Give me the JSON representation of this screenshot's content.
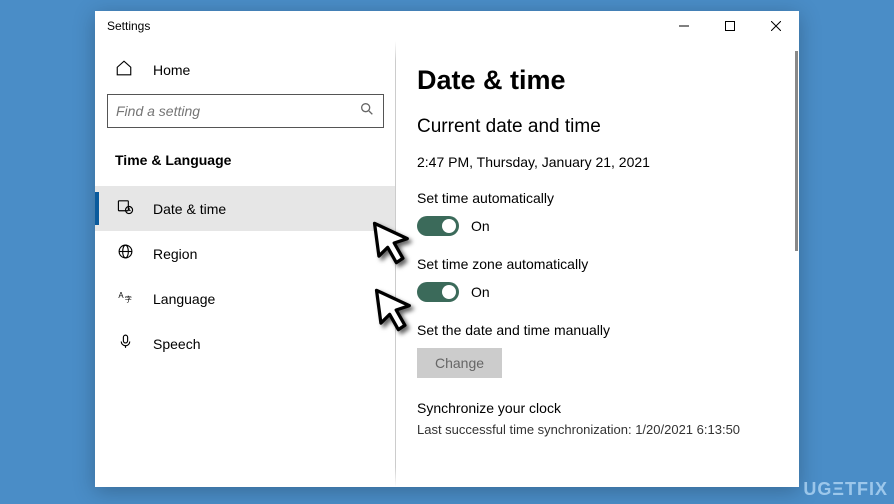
{
  "window": {
    "title": "Settings"
  },
  "sidebar": {
    "home_label": "Home",
    "search_placeholder": "Find a setting",
    "section": "Time & Language",
    "items": [
      {
        "label": "Date & time"
      },
      {
        "label": "Region"
      },
      {
        "label": "Language"
      },
      {
        "label": "Speech"
      }
    ]
  },
  "main": {
    "heading": "Date & time",
    "subheading": "Current date and time",
    "timestamp": "2:47 PM, Thursday, January 21, 2021",
    "set_time_auto_label": "Set time automatically",
    "set_time_auto_state": "On",
    "set_tz_auto_label": "Set time zone automatically",
    "set_tz_auto_state": "On",
    "manual_label": "Set the date and time manually",
    "change_label": "Change",
    "sync_heading": "Synchronize your clock",
    "sync_status": "Last successful time synchronization: 1/20/2021 6:13:50"
  },
  "watermark": "UGΞTFIX"
}
